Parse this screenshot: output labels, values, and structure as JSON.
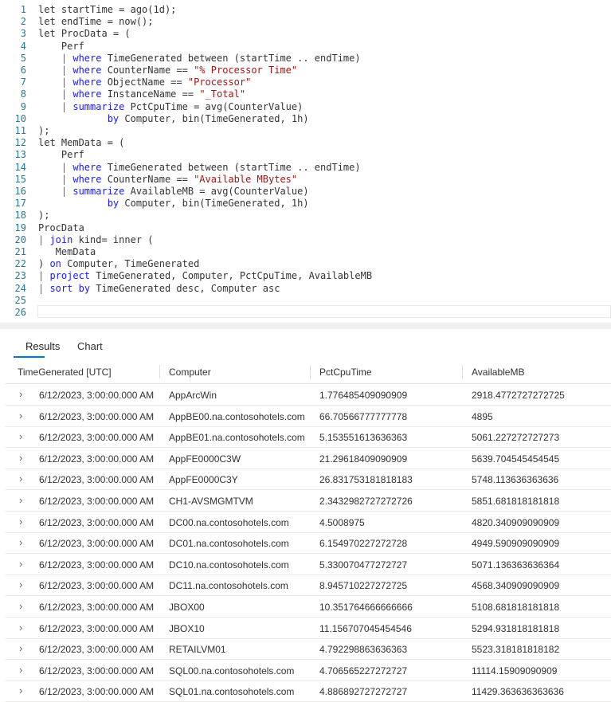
{
  "editor": {
    "lines": [
      [
        [
          "t",
          "let startTime = ago(1d);"
        ]
      ],
      [
        [
          "t",
          "let endTime = now();"
        ]
      ],
      [
        [
          "t",
          "let ProcData = ("
        ]
      ],
      [
        [
          "t",
          "    Perf"
        ]
      ],
      [
        [
          "p",
          "    | "
        ],
        [
          "k",
          "where"
        ],
        [
          "t",
          " TimeGenerated between (startTime .. endTime)"
        ]
      ],
      [
        [
          "p",
          "    | "
        ],
        [
          "k",
          "where"
        ],
        [
          "t",
          " CounterName == "
        ],
        [
          "s",
          "\"% Processor Time\""
        ]
      ],
      [
        [
          "p",
          "    | "
        ],
        [
          "k",
          "where"
        ],
        [
          "t",
          " ObjectName == "
        ],
        [
          "s",
          "\"Processor\""
        ]
      ],
      [
        [
          "p",
          "    | "
        ],
        [
          "k",
          "where"
        ],
        [
          "t",
          " InstanceName == "
        ],
        [
          "s",
          "\"_Total\""
        ]
      ],
      [
        [
          "p",
          "    | "
        ],
        [
          "k",
          "summarize"
        ],
        [
          "t",
          " PctCpuTime = avg(CounterValue)"
        ]
      ],
      [
        [
          "t",
          "            "
        ],
        [
          "k",
          "by"
        ],
        [
          "t",
          " Computer, bin(TimeGenerated, 1h)"
        ]
      ],
      [
        [
          "t",
          ");"
        ]
      ],
      [
        [
          "t",
          "let MemData = ("
        ]
      ],
      [
        [
          "t",
          "    Perf"
        ]
      ],
      [
        [
          "p",
          "    | "
        ],
        [
          "k",
          "where"
        ],
        [
          "t",
          " TimeGenerated between (startTime .. endTime)"
        ]
      ],
      [
        [
          "p",
          "    | "
        ],
        [
          "k",
          "where"
        ],
        [
          "t",
          " CounterName == "
        ],
        [
          "s",
          "\"Available MBytes\""
        ]
      ],
      [
        [
          "p",
          "    | "
        ],
        [
          "k",
          "summarize"
        ],
        [
          "t",
          " AvailableMB = avg(CounterValue)"
        ]
      ],
      [
        [
          "t",
          "            "
        ],
        [
          "k",
          "by"
        ],
        [
          "t",
          " Computer, bin(TimeGenerated, 1h)"
        ]
      ],
      [
        [
          "t",
          ");"
        ]
      ],
      [
        [
          "t",
          "ProcData"
        ]
      ],
      [
        [
          "p",
          "| "
        ],
        [
          "k",
          "join"
        ],
        [
          "t",
          " kind= inner ("
        ]
      ],
      [
        [
          "t",
          "   MemData"
        ]
      ],
      [
        [
          "t",
          ") "
        ],
        [
          "k",
          "on"
        ],
        [
          "t",
          " Computer, TimeGenerated"
        ]
      ],
      [
        [
          "p",
          "| "
        ],
        [
          "k",
          "project"
        ],
        [
          "t",
          " TimeGenerated, Computer, PctCpuTime, AvailableMB"
        ]
      ],
      [
        [
          "p",
          "| "
        ],
        [
          "k",
          "sort"
        ],
        [
          "t",
          " "
        ],
        [
          "k",
          "by"
        ],
        [
          "t",
          " TimeGenerated desc, Computer asc"
        ]
      ],
      [],
      []
    ]
  },
  "tabs": [
    {
      "label": "Results",
      "active": true
    },
    {
      "label": "Chart",
      "active": false
    }
  ],
  "table": {
    "columns": [
      "TimeGenerated [UTC]",
      "Computer",
      "PctCpuTime",
      "AvailableMB"
    ],
    "expand_icon": "›",
    "rows": [
      [
        "6/12/2023, 3:00:00.000 AM",
        "AppArcWin",
        "1.776485409090909",
        "2918.4772727272725"
      ],
      [
        "6/12/2023, 3:00:00.000 AM",
        "AppBE00.na.contosohotels.com",
        "66.70566777777778",
        "4895"
      ],
      [
        "6/12/2023, 3:00:00.000 AM",
        "AppBE01.na.contosohotels.com",
        "5.153551613636363",
        "5061.227272727273"
      ],
      [
        "6/12/2023, 3:00:00.000 AM",
        "AppFE0000C3W",
        "21.29618409090909",
        "5639.704545454545"
      ],
      [
        "6/12/2023, 3:00:00.000 AM",
        "AppFE0000C3Y",
        "26.831753181818183",
        "5748.113636363636"
      ],
      [
        "6/12/2023, 3:00:00.000 AM",
        "CH1-AVSMGMTVM",
        "2.3432982727272726",
        "5851.681818181818"
      ],
      [
        "6/12/2023, 3:00:00.000 AM",
        "DC00.na.contosohotels.com",
        "4.5008975",
        "4820.340909090909"
      ],
      [
        "6/12/2023, 3:00:00.000 AM",
        "DC01.na.contosohotels.com",
        "6.154970227272728",
        "4949.590909090909"
      ],
      [
        "6/12/2023, 3:00:00.000 AM",
        "DC10.na.contosohotels.com",
        "5.330070477272727",
        "5071.136363636364"
      ],
      [
        "6/12/2023, 3:00:00.000 AM",
        "DC11.na.contosohotels.com",
        "8.945710227272725",
        "4568.340909090909"
      ],
      [
        "6/12/2023, 3:00:00.000 AM",
        "JBOX00",
        "10.351764666666666",
        "5108.681818181818"
      ],
      [
        "6/12/2023, 3:00:00.000 AM",
        "JBOX10",
        "11.156707045454546",
        "5294.931818181818"
      ],
      [
        "6/12/2023, 3:00:00.000 AM",
        "RETAILVM01",
        "4.792298863636363",
        "5523.318181818182"
      ],
      [
        "6/12/2023, 3:00:00.000 AM",
        "SQL00.na.contosohotels.com",
        "4.706565227272727",
        "11114.15909090909"
      ],
      [
        "6/12/2023, 3:00:00.000 AM",
        "SQL01.na.contosohotels.com",
        "4.886892727272727",
        "11429.363636363636"
      ]
    ]
  }
}
